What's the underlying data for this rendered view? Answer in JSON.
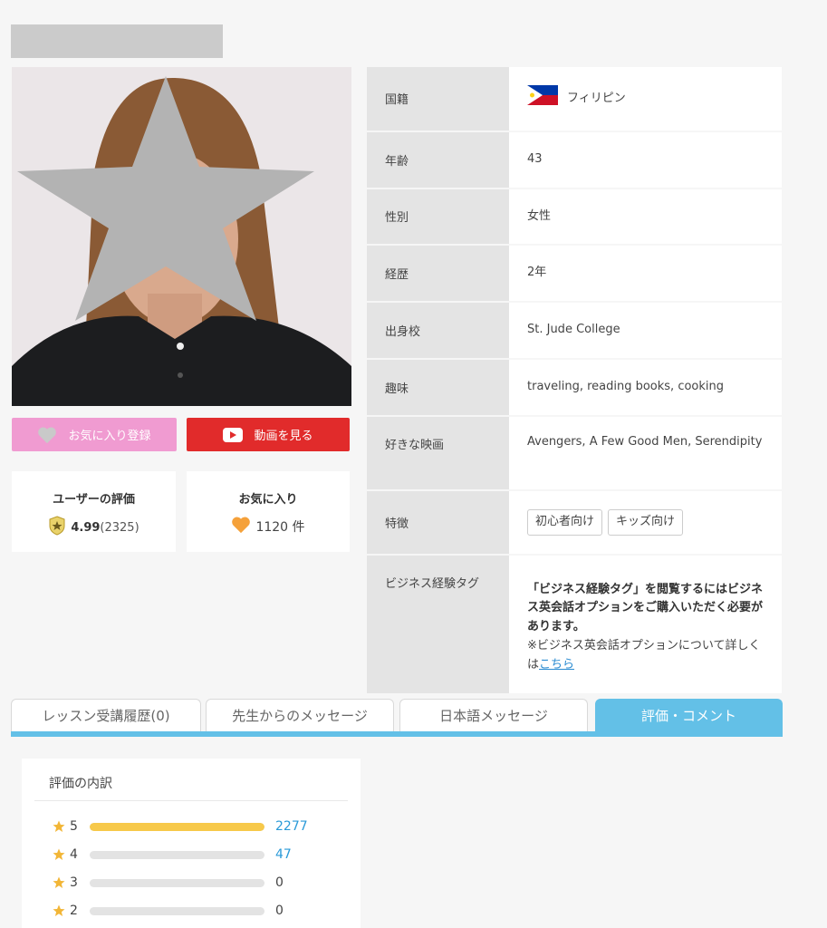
{
  "profile_fields": [
    {
      "label": "国籍",
      "value": "フィリピン"
    },
    {
      "label": "年齢",
      "value": "43"
    },
    {
      "label": "性別",
      "value": "女性"
    },
    {
      "label": "経歴",
      "value": "2年"
    },
    {
      "label": "出身校",
      "value": "St. Jude College"
    },
    {
      "label": "趣味",
      "value": "traveling, reading books, cooking"
    },
    {
      "label": "好きな映画",
      "value": "Avengers, A Few Good Men, Serendipity"
    },
    {
      "label": "特徴",
      "tags": [
        "初心者向け",
        "キッズ向け"
      ]
    },
    {
      "label": "ビジネス経験タグ",
      "note_bold": "「ビジネス経験タグ」を閲覧するにはビジネス英会話オプションをご購入いただく必要があります。",
      "note_text": "※ビジネス英会話オプションについて詳しくは",
      "note_link": "こちら"
    }
  ],
  "buttons": {
    "favorite": "お気に入り登録",
    "video": "動画を見る"
  },
  "stats": {
    "rating_title": "ユーザーの評価",
    "rating_score": "4.99",
    "rating_count": "(2325)",
    "fav_title": "お気に入り",
    "fav_value": "1120 件"
  },
  "tabs": [
    {
      "label": "レッスン受講履歴(0)",
      "active": false
    },
    {
      "label": "先生からのメッセージ",
      "active": false
    },
    {
      "label": "日本語メッセージ",
      "active": false
    },
    {
      "label": "評価・コメント",
      "active": true
    }
  ],
  "breakdown": {
    "title": "評価の内訳",
    "rows": [
      {
        "level": "5",
        "count": "2277",
        "fraction": 1.0,
        "link": true
      },
      {
        "level": "4",
        "count": "47",
        "fraction": 0.0,
        "link": true
      },
      {
        "level": "3",
        "count": "0",
        "fraction": 0.0,
        "link": false
      },
      {
        "level": "2",
        "count": "0",
        "fraction": 0.0,
        "link": false
      }
    ]
  },
  "colors": {
    "accent_tab": "#63c0e7",
    "fav_pink": "#f09bd1",
    "video_red": "#e12b2b",
    "bar_yellow": "#f7c94a",
    "link_blue": "#2a9ad8"
  },
  "icons": [
    "heart-icon",
    "play-icon",
    "medal-star-icon",
    "heart-orange-icon",
    "philippines-flag-icon",
    "star-icon"
  ]
}
